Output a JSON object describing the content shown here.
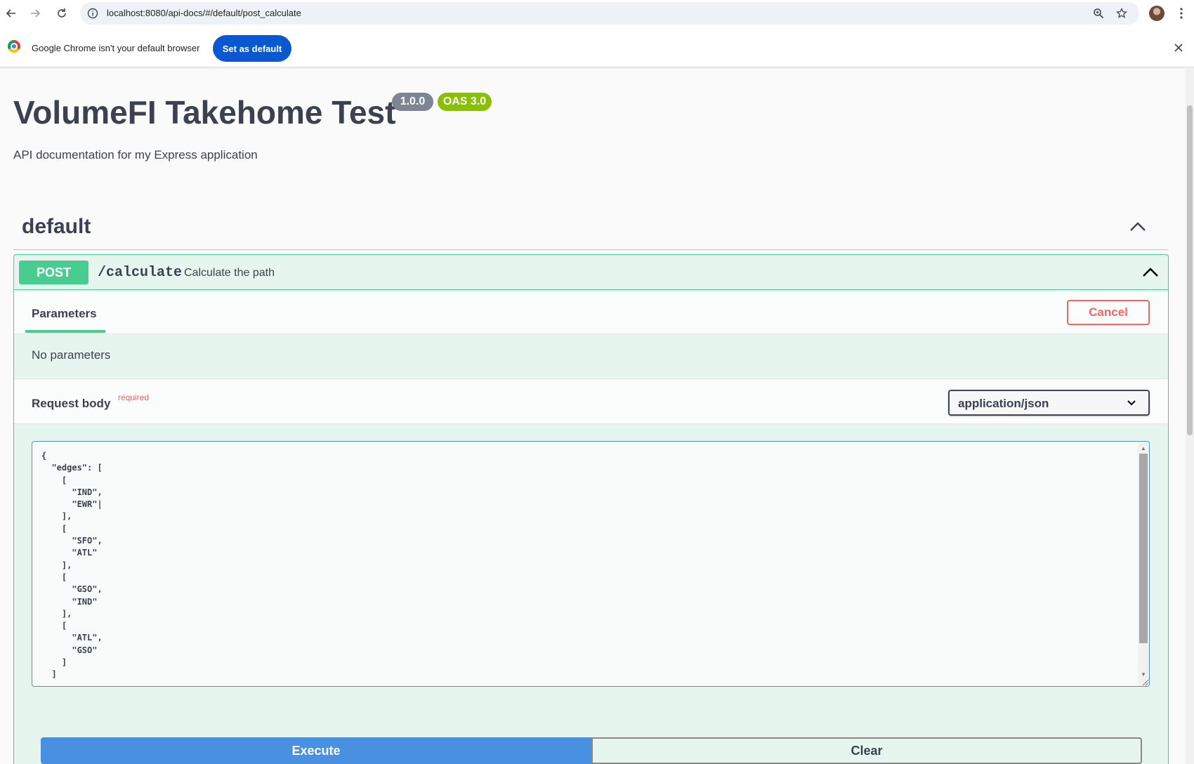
{
  "browser": {
    "url": "localhost:8080/api-docs/#/default/post_calculate",
    "infobar_message": "Google Chrome isn't your default browser",
    "set_default_label": "Set as default"
  },
  "page": {
    "title": "VolumeFI Takehome Test",
    "version_badge": "1.0.0",
    "oas_badge": "OAS 3.0",
    "description": "API documentation for my Express application"
  },
  "tag": {
    "name": "default"
  },
  "operation": {
    "method": "POST",
    "path": "/calculate",
    "summary": "Calculate the path",
    "parameters_tab": "Parameters",
    "cancel_label": "Cancel",
    "no_parameters": "No parameters",
    "request_body_label": "Request body",
    "required_label": "required",
    "content_type": "application/json",
    "request_body": "{\n  \"edges\": [\n    [\n      \"IND\",\n      \"EWR\"|\n    ],\n    [\n      \"SFO\",\n      \"ATL\"\n    ],\n    [\n      \"GSO\",\n      \"IND\"\n    ],\n    [\n      \"ATL\",\n      \"GSO\"\n    ]\n  ]\n,",
    "execute_label": "Execute",
    "clear_label": "Clear"
  },
  "colors": {
    "post_green": "#49cc90",
    "execute_blue": "#4990e2",
    "cancel_red": "#ff6060",
    "chrome_blue": "#0b57d0"
  }
}
